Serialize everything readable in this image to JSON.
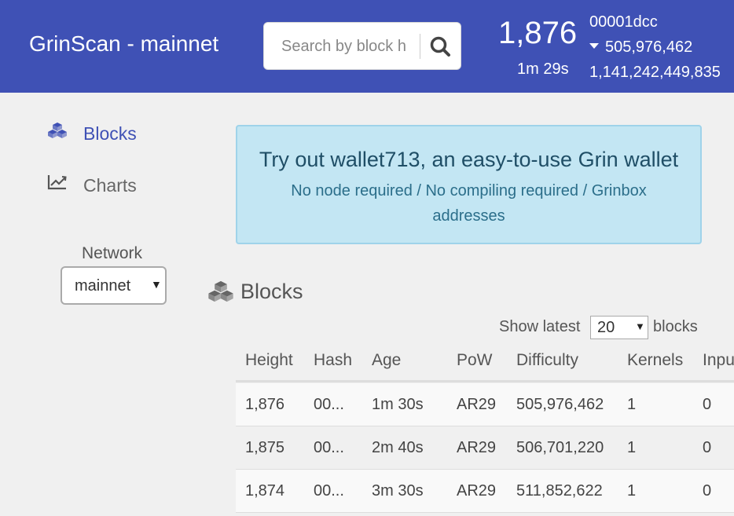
{
  "header": {
    "brand": "GrinScan - mainnet",
    "search_placeholder": "Search by block h",
    "height": "1,876",
    "age": "1m 29s",
    "hash_prefix": "00001dcc",
    "difficulty": "505,976,462",
    "total_difficulty": "1,141,242,449,835"
  },
  "sidebar": {
    "items": [
      {
        "label": "Blocks",
        "icon": "cubes-icon"
      },
      {
        "label": "Charts",
        "icon": "line-chart-icon"
      }
    ],
    "network_label": "Network",
    "network_selected": "mainnet"
  },
  "alert": {
    "title": "Try out wallet713, an easy-to-use Grin wallet",
    "subtitle": "No node required / No compiling required / Grinbox addresses"
  },
  "blocks": {
    "title": "Blocks",
    "show_prefix": "Show latest",
    "show_value": "20",
    "show_suffix": "blocks",
    "columns": [
      "Height",
      "Hash",
      "Age",
      "PoW",
      "Difficulty",
      "Kernels",
      "Inpu"
    ],
    "rows": [
      [
        "1,876",
        "00...",
        "1m 30s",
        "AR29",
        "505,976,462",
        "1",
        "0"
      ],
      [
        "1,875",
        "00...",
        "2m 40s",
        "AR29",
        "506,701,220",
        "1",
        "0"
      ],
      [
        "1,874",
        "00...",
        "3m 30s",
        "AR29",
        "511,852,622",
        "1",
        "0"
      ]
    ]
  },
  "colors": {
    "header_bg": "#3f51b5",
    "accent": "#3f51b5",
    "alert_bg": "#c3e6f3"
  }
}
